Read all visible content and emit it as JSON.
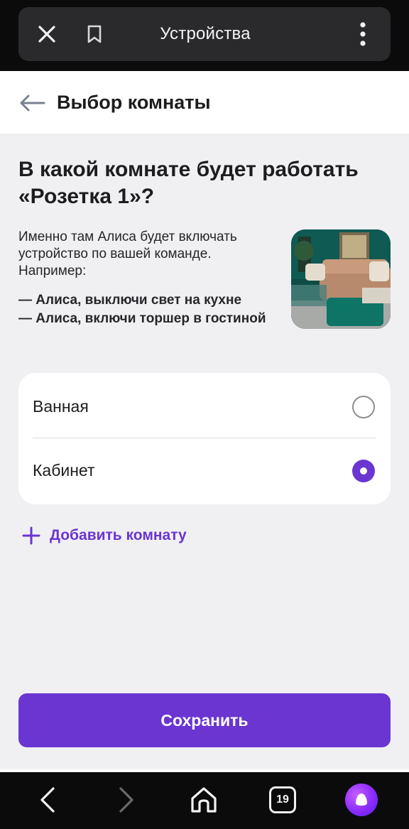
{
  "browser": {
    "title": "Устройства",
    "icons": {
      "close": "close-icon",
      "bookmark": "bookmark-icon",
      "more": "more-vertical-icon"
    }
  },
  "header": {
    "title": "Выбор комнаты",
    "back_icon": "arrow-left-icon"
  },
  "content": {
    "question": "В какой комнате будет работать «Розетка 1»?",
    "description": "Именно там Алиса будет включать устройство по вашей команде. Например:",
    "examples": [
      "— Алиса, выключи свет на кухне",
      "— Алиса, включи торшер в гостиной"
    ],
    "image": "living-room-photo"
  },
  "rooms": [
    {
      "label": "Ванная",
      "selected": false
    },
    {
      "label": "Кабинет",
      "selected": true
    }
  ],
  "add_room_label": "Добавить комнату",
  "save_label": "Сохранить",
  "bottom_nav": {
    "tabs_count": "19",
    "icons": [
      "chevron-left-icon",
      "chevron-right-icon",
      "home-icon",
      "tabs-icon",
      "alice-icon"
    ]
  },
  "colors": {
    "accent": "#6a35d0",
    "background": "#f0f0f3",
    "browser_bar": "#0b0b0c"
  }
}
